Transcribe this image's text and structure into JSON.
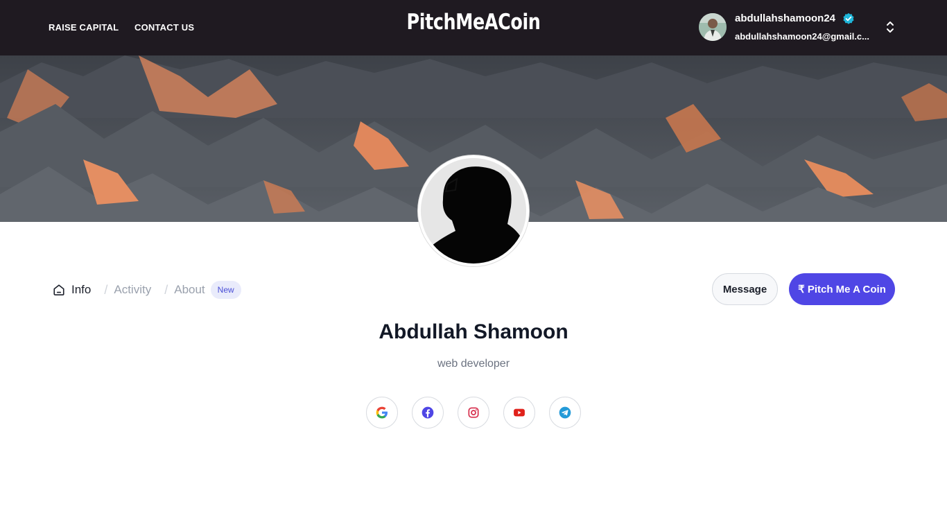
{
  "navbar": {
    "links": [
      "RAISE CAPITAL",
      "CONTACT US"
    ],
    "brand": "PitchMeACoin",
    "user": {
      "username": "abdullahshamoon24",
      "email": "abdullahshamoon24@gmail.c..."
    }
  },
  "tabs": {
    "info": "Info",
    "separator": "/",
    "activity": "Activity",
    "about": "About",
    "badge": "New"
  },
  "actions": {
    "message": "Message",
    "pitch": "₹ Pitch Me A Coin"
  },
  "profile": {
    "name": "Abdullah Shamoon",
    "role": "web developer"
  },
  "social_icons": [
    "google-icon",
    "facebook-icon",
    "instagram-icon",
    "youtube-icon",
    "telegram-icon"
  ],
  "colors": {
    "navbar_bg": "#1f1a21",
    "accent": "#4f46e5",
    "verified": "#1fb6d9"
  }
}
